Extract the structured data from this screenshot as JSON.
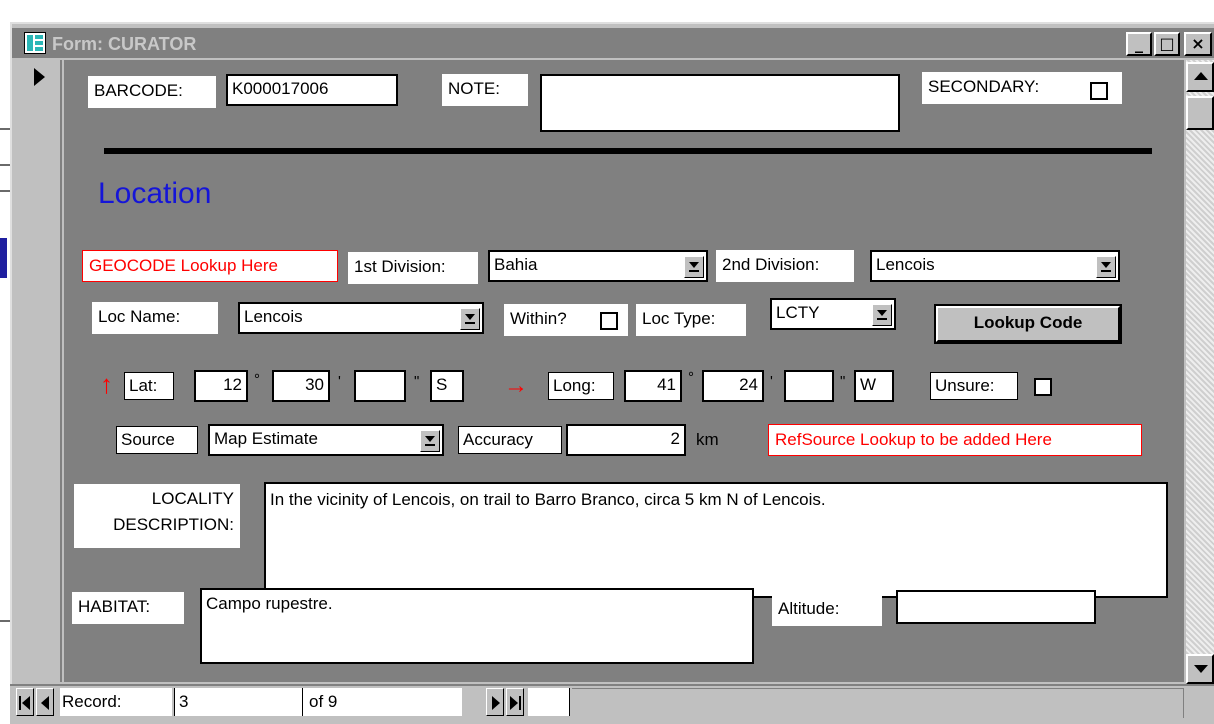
{
  "window": {
    "title": "Form: CURATOR",
    "minimize_glyph": "_",
    "maximize_glyph": "□",
    "close_glyph": "×"
  },
  "header": {
    "barcode_label": "BARCODE:",
    "barcode_value": "K000017006",
    "note_label": "NOTE:",
    "note_value": "",
    "secondary_label": "SECONDARY:",
    "secondary_checked": false
  },
  "section_title": "Location",
  "geocode_lookup_label": "GEOCODE Lookup Here",
  "division": {
    "first_label": "1st Division:",
    "first_value": "Bahia",
    "second_label": "2nd Division:",
    "second_value": "Lencois"
  },
  "locality": {
    "name_label": "Loc Name:",
    "name_value": "Lencois",
    "within_label": "Within?",
    "within_checked": false,
    "type_label": "Loc Type:",
    "type_value": "LCTY",
    "lookup_button": "Lookup Code"
  },
  "coordinates": {
    "lat_arrow": "↑",
    "lat_label": "Lat:",
    "lat_deg": "12",
    "lat_min": "30",
    "lat_sec": "",
    "lat_hemi": "S",
    "long_arrow": "→",
    "long_label": "Long:",
    "long_deg": "41",
    "long_min": "24",
    "long_sec": "",
    "long_hemi": "W",
    "deg_symbol": "°",
    "min_symbol": "'",
    "sec_symbol": "\"",
    "unsure_label": "Unsure:",
    "unsure_checked": false
  },
  "source": {
    "label": "Source",
    "value": "Map Estimate",
    "accuracy_label": "Accuracy",
    "accuracy_value": "2",
    "accuracy_unit": "km",
    "refsource_note": "RefSource Lookup to be added Here"
  },
  "description": {
    "label_line1": "LOCALITY",
    "label_line2": "DESCRIPTION:",
    "value": "In the vicinity of Lencois, on trail to Barro Branco, circa 5 km N of Lencois."
  },
  "habitat": {
    "label": "HABITAT:",
    "value": "Campo rupestre.",
    "altitude_label": "Altitude:",
    "altitude_value": ""
  },
  "navigation": {
    "record_label": "Record:",
    "record_value": "3",
    "of_label": "of",
    "total": "9"
  },
  "icons": {
    "window_icon": "form-icon",
    "record_selector": "record-pointer-icon",
    "scroll_up": "scroll-up-arrow-icon",
    "scroll_down": "scroll-down-arrow-icon",
    "nav_first": "first-record-icon",
    "nav_prev": "previous-record-icon",
    "nav_next": "next-record-icon",
    "nav_last": "last-record-icon"
  },
  "colors": {
    "form_background": "#808080",
    "heading": "#1515d8",
    "warning_text": "#ff0000",
    "title_bar": "#808080"
  }
}
